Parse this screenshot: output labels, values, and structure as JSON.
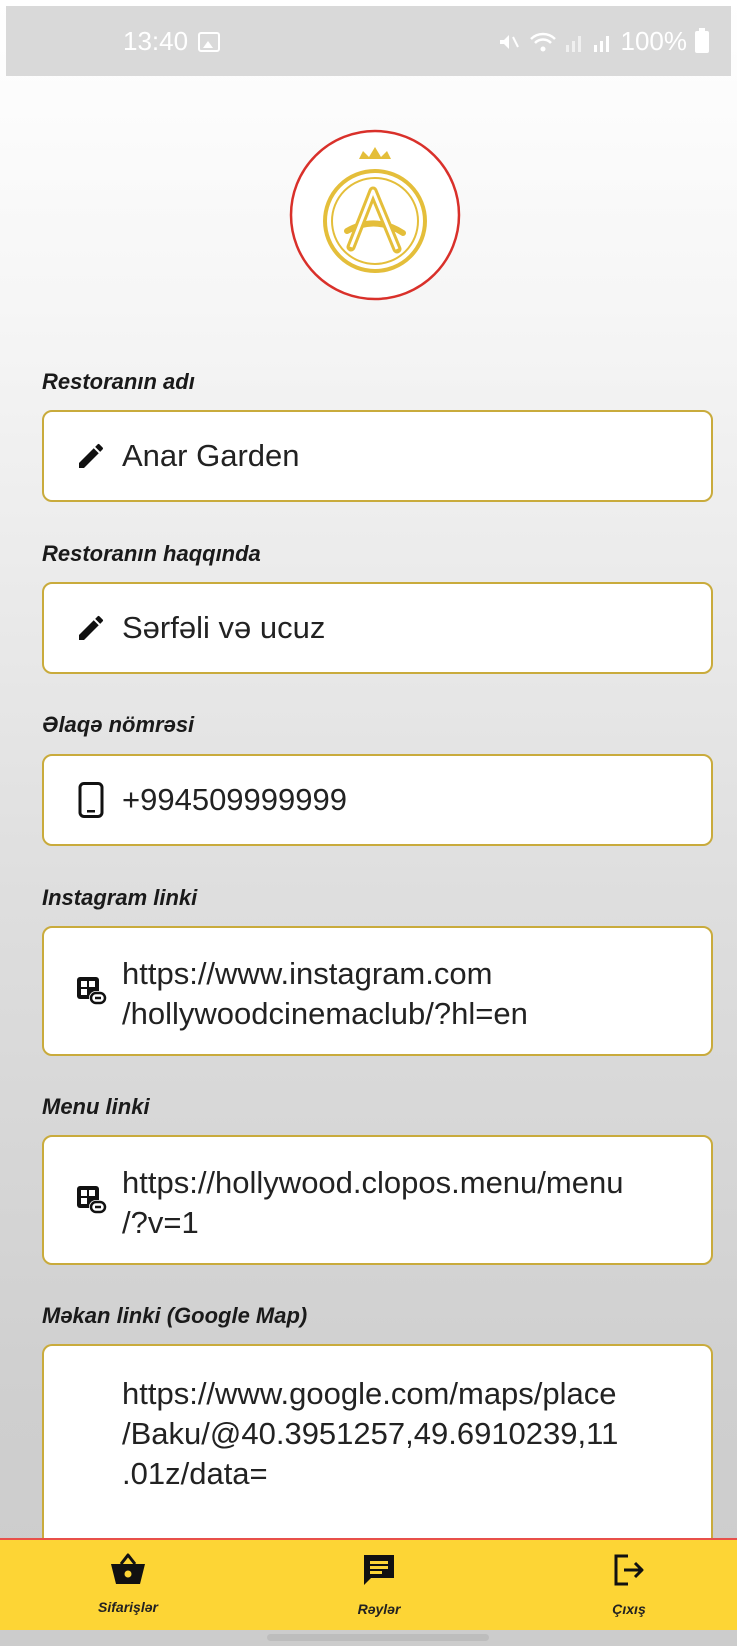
{
  "status_bar": {
    "time": "13:40",
    "battery": "100%"
  },
  "form": {
    "name": {
      "label": "Restoranın adı",
      "value": "Anar Garden",
      "icon": "pencil-icon"
    },
    "about": {
      "label": "Restoranın haqqında",
      "value": "Sərfəli və ucuz",
      "icon": "pencil-icon"
    },
    "phone": {
      "label": "Əlaqə nömrəsi",
      "value": "+994509999999",
      "icon": "phone-icon"
    },
    "instagram": {
      "label": "Instagram linki",
      "line1": "https://www.instagram.com",
      "line2": "/hollywoodcinemaclub/?hl=en",
      "icon": "link-icon"
    },
    "menu": {
      "label": "Menu linki",
      "line1": "https://hollywood.clopos.menu/menu",
      "line2": "/?v=1",
      "icon": "link-icon"
    },
    "map": {
      "label": "Məkan linki (Google Map)",
      "line1": "https://www.google.com/maps/place",
      "line2": "/Baku/@40.3951257,49.6910239,11",
      "line3": ".01z/data="
    }
  },
  "bottom_nav": {
    "orders": "Sifarişlər",
    "reviews": "Rəylər",
    "logout": "Çıxış"
  },
  "colors": {
    "accent": "#fdd535",
    "border": "#c9ab3c",
    "logo_ring": "#d9302a",
    "logo_gold": "#e4be3a"
  }
}
